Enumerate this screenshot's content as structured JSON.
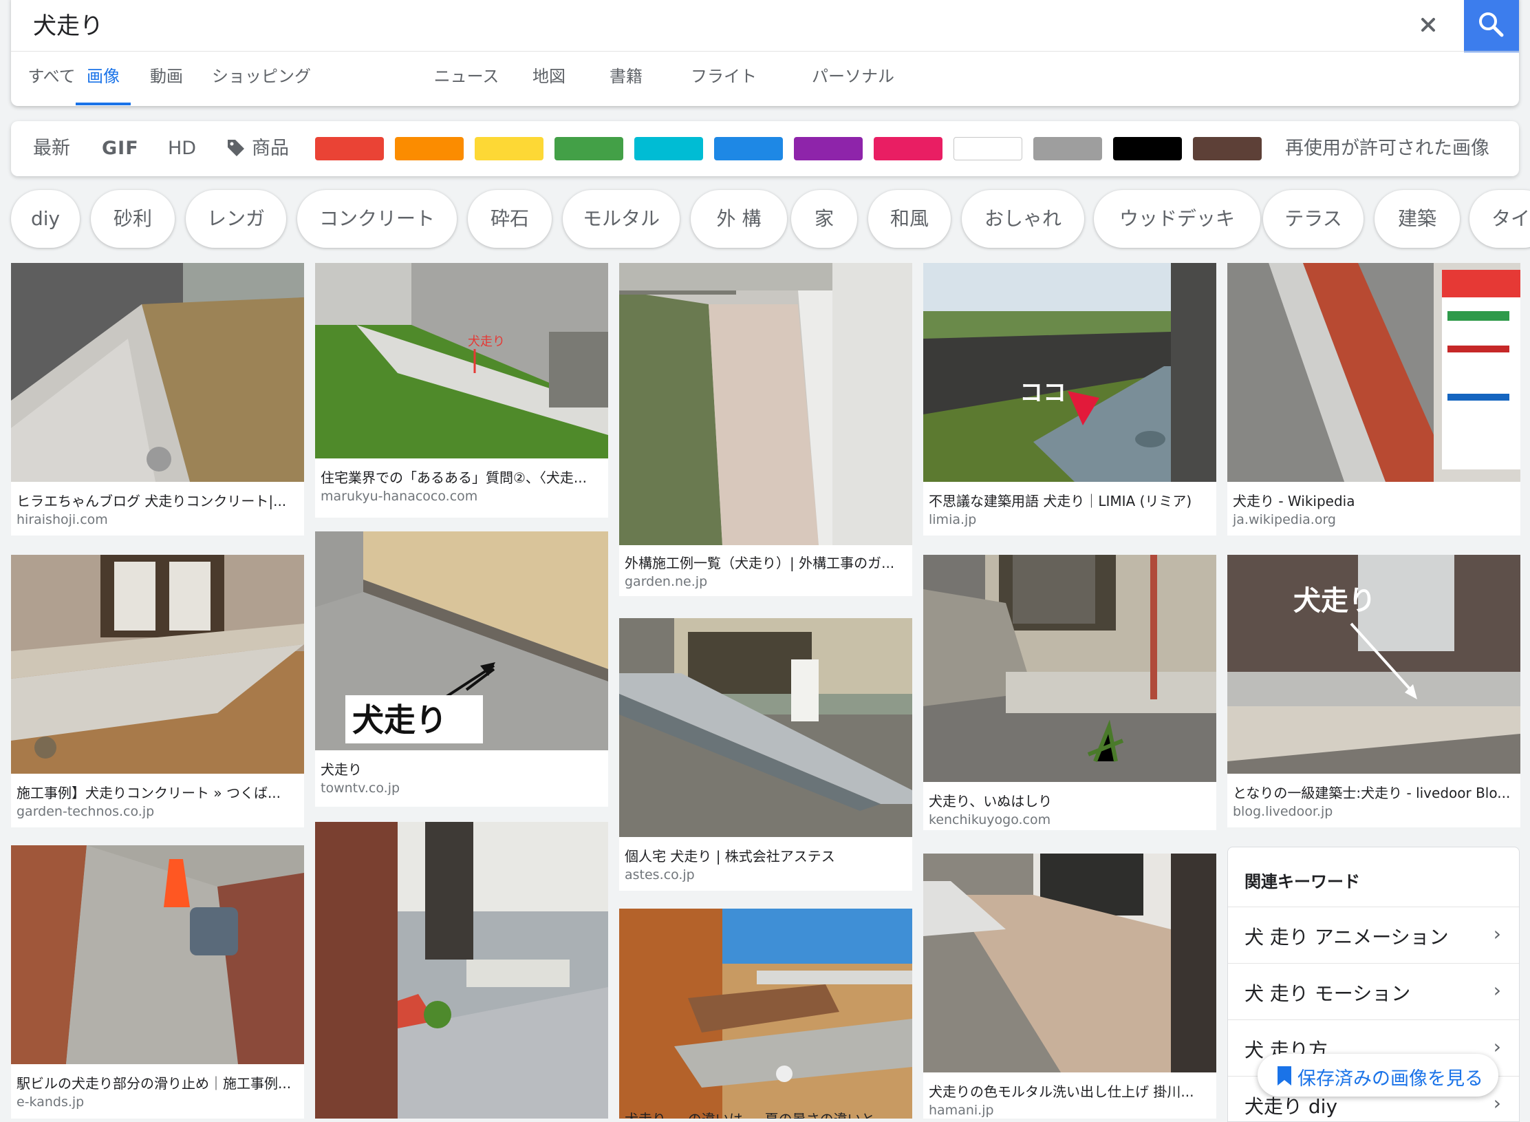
{
  "search": {
    "query": "犬走り"
  },
  "tabs": [
    "すべて",
    "画像",
    "動画",
    "ショッピング",
    "ニュース",
    "地図",
    "書籍",
    "フライト",
    "パーソナル"
  ],
  "active_tab": "画像",
  "filters": {
    "latest": "最新",
    "gif": "GIF",
    "hd": "HD",
    "products": "商品",
    "reuse": "再使用が許可された画像",
    "colors": [
      "#ea4335",
      "#fb8c00",
      "#fdd835",
      "#43a047",
      "#00bcd4",
      "#1e88e5",
      "#8e24aa",
      "#e91e63",
      "#ffffff",
      "#9e9e9e",
      "#000000",
      "#5d4037"
    ]
  },
  "chips": [
    "diy",
    "砂利",
    "レンガ",
    "コンクリート",
    "砕石",
    "モルタル",
    "外 構",
    "家",
    "和風",
    "おしゃれ",
    "ウッドデッキ",
    "テラス",
    "建築",
    "タイ"
  ],
  "results": [
    {
      "title": "ヒラエちゃんブログ 犬走りコンクリート|...",
      "domain": "hiraishoji.com"
    },
    {
      "title": "住宅業界での「あるある」質問②、〈犬走...",
      "domain": "marukyu-hanacoco.com",
      "overlay": "犬走り"
    },
    {
      "title": "外構施工例一覧（犬走り）| 外構工事のガ...",
      "domain": "garden.ne.jp"
    },
    {
      "title": "不思議な建築用語 犬走り｜LIMIA (リミア)",
      "domain": "limia.jp",
      "overlay": "ココ"
    },
    {
      "title": "犬走り - Wikipedia",
      "domain": "ja.wikipedia.org"
    },
    {
      "title": "施工事例】犬走りコンクリート » つくば...",
      "domain": "garden-technos.co.jp"
    },
    {
      "title": "犬走り",
      "domain": "towntv.co.jp",
      "overlay": "犬走り"
    },
    {
      "title": "個人宅 犬走り | 株式会社アステス",
      "domain": "astes.co.jp"
    },
    {
      "title": "犬走り、いぬはしり",
      "domain": "kenchikuyogo.com"
    },
    {
      "title": "となりの一級建築士:犬走り - livedoor Blo...",
      "domain": "blog.livedoor.jp",
      "overlay": "犬走り"
    },
    {
      "title": "駅ビルの犬走り部分の滑り止め｜施工事例...",
      "domain": "e-kands.jp"
    },
    {
      "title": "犬走りの色モルタル洗い出し仕上げ 掛川...",
      "domain": "hamani.jp"
    },
    {
      "title": "犬走り ... の違いは ... 夏の暑さの違いと ...",
      "domain": ""
    }
  ],
  "related": {
    "title": "関連キーワード",
    "items": [
      "犬 走り アニメーション",
      "犬 走り モーション",
      "犬 走り方",
      "犬走り diy"
    ]
  },
  "saved_button": "保存済みの画像を見る"
}
